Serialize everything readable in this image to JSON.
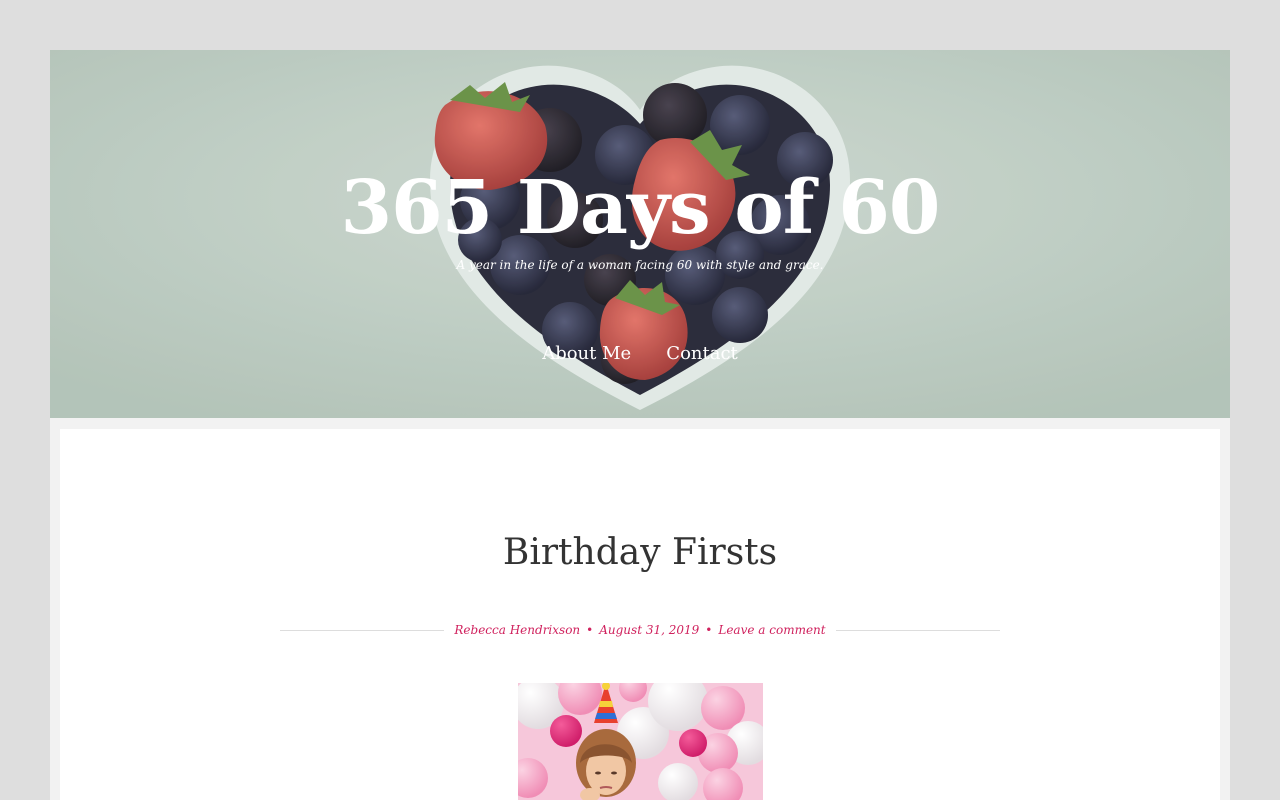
{
  "site": {
    "title": "365 Days of 60",
    "tagline": "A year in the life of a woman facing 60 with style and grace."
  },
  "nav": {
    "items": [
      {
        "label": "About Me"
      },
      {
        "label": "Contact"
      }
    ]
  },
  "post": {
    "title": "Birthday Firsts",
    "author": "Rebecca Hendrixson",
    "date": "August 31, 2019",
    "comments": "Leave a comment",
    "separator": "•"
  },
  "colors": {
    "accent": "#d0225e",
    "page_background": "#dedede",
    "content_background": "#ffffff",
    "title_text": "#333333"
  }
}
